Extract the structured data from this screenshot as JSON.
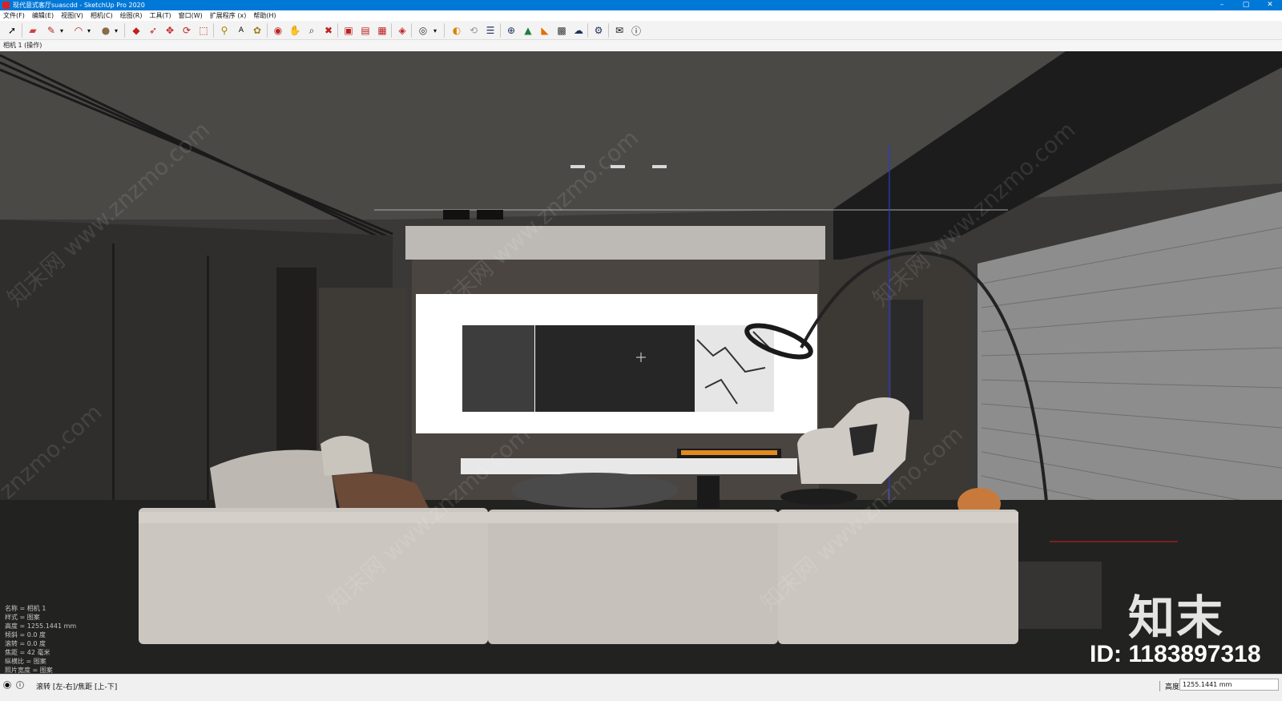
{
  "window": {
    "title": "现代意式客厅suascdd - SketchUp Pro 2020",
    "buttons": [
      "–",
      "▢",
      "✕"
    ]
  },
  "menu": [
    "文件(F)",
    "编辑(E)",
    "视图(V)",
    "相机(C)",
    "绘图(R)",
    "工具(T)",
    "窗口(W)",
    "扩展程序 (x)",
    "帮助(H)"
  ],
  "toolbar": {
    "icons": [
      "select-arrow-icon",
      "eraser-icon",
      "pencil-icon",
      "dropdown-arrow-icon",
      "arc-icon",
      "dropdown-arrow-icon",
      "paint-bucket-icon",
      "dropdown-arrow-icon",
      "push-pull-icon",
      "follow-me-icon",
      "move-icon",
      "rotate-icon",
      "scale-icon",
      "tape-measure-icon",
      "text-icon",
      "paint-icon",
      "orbit-icon",
      "pan-icon",
      "zoom-icon",
      "zoom-extents-icon",
      "warehouse-icon",
      "extension-warehouse-icon",
      "layout-icon",
      "ruby-icon",
      "account-icon",
      "dropdown-arrow-icon",
      "plugin-orange-icon",
      "refresh-icon",
      "stack-icon",
      "add-circle-icon",
      "tree-icon",
      "materials-icon",
      "checker-icon",
      "cloud-upload-icon",
      "gears-icon",
      "mail-icon",
      "info-icon"
    ]
  },
  "scene_tab": "相机 1 (操作)",
  "camera_info": [
    "名称 = 相机 1",
    "样式 = 图案",
    "高度 = 1255.1441 mm",
    "倾斜 = 0.0 度",
    "滚转 = 0.0 度",
    "焦距 = 42 毫米",
    "纵横比 = 图案",
    "照片宽度 = 图案"
  ],
  "watermark": {
    "brand": "知末",
    "id": "ID: 1183897318",
    "site": "www.znzmo.com",
    "cn": "知末网"
  },
  "status": {
    "hint": "滚转 [左-右]/焦距 [上-下]",
    "measure_label": "高度",
    "measure_value": "1255.1441 mm"
  },
  "colors": {
    "titlebar": "#0078d7",
    "viewport_bg": "#3a3937",
    "tv_frame": "#ffffff",
    "sofa": "#cbc7c0"
  }
}
